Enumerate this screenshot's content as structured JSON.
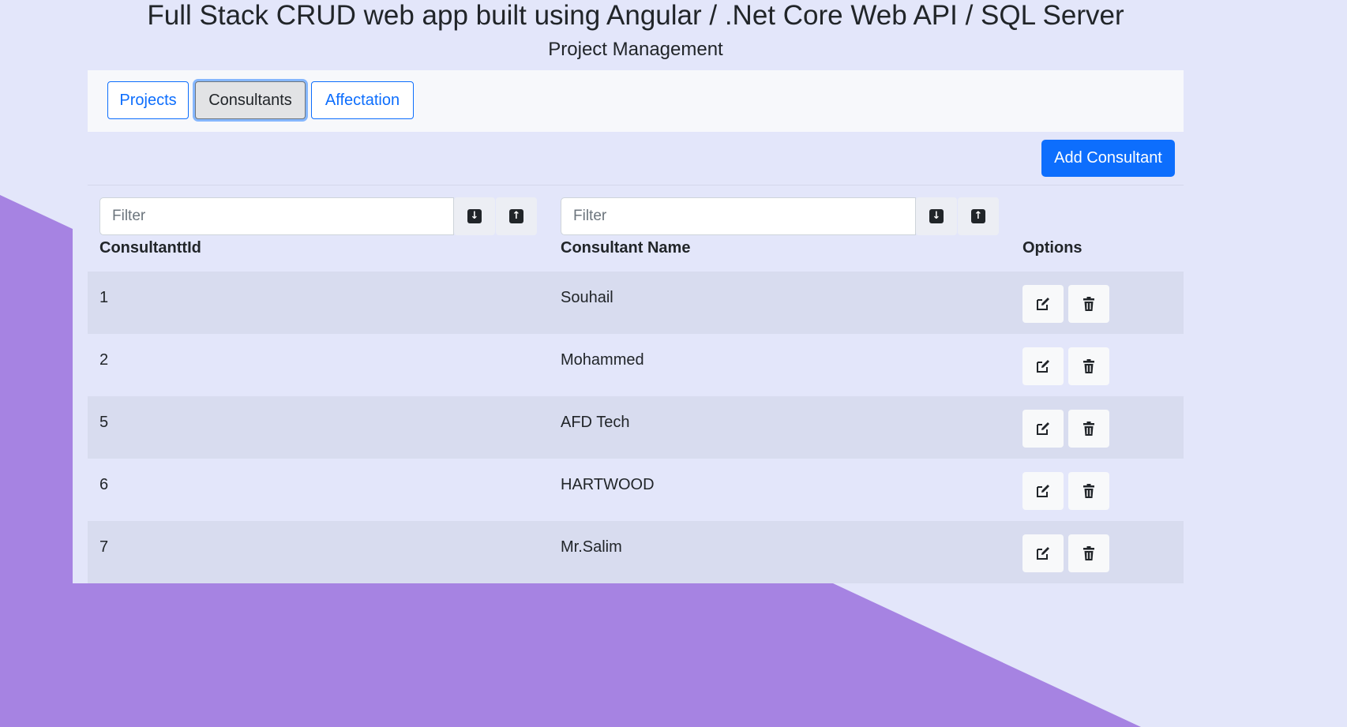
{
  "header": {
    "title": "Full Stack CRUD web app built using Angular / .Net Core Web API / SQL Server",
    "subtitle": "Project Management"
  },
  "nav": {
    "tabs": [
      {
        "label": "Projects"
      },
      {
        "label": "Consultants",
        "active": true
      },
      {
        "label": "Affectation"
      }
    ]
  },
  "toolbar": {
    "add_label": "Add Consultant"
  },
  "filters": {
    "id_placeholder": "Filter",
    "name_placeholder": "Filter",
    "sort_desc_icon": "arrow-down-square-icon",
    "sort_asc_icon": "arrow-up-square-icon"
  },
  "table": {
    "columns": [
      "ConsultanttId",
      "Consultant Name",
      "Options"
    ],
    "rows": [
      {
        "id": "1",
        "name": "Souhail"
      },
      {
        "id": "2",
        "name": "Mohammed"
      },
      {
        "id": "5",
        "name": "AFD Tech"
      },
      {
        "id": "6",
        "name": "HARTWOOD"
      },
      {
        "id": "7",
        "name": "Mr.Salim"
      }
    ],
    "edit_icon": "pencil-square-icon",
    "delete_icon": "trash-icon"
  },
  "colors": {
    "background": "#e3e6fa",
    "accent_shape": "#a683e2",
    "primary": "#0d6efd"
  }
}
